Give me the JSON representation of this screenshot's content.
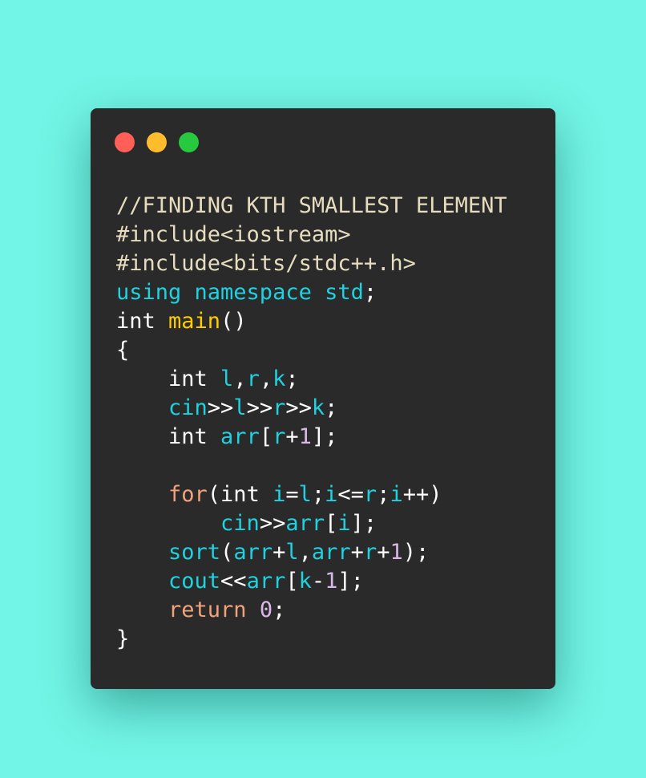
{
  "colors": {
    "background": "#72f5e6",
    "window": "#2a2a2a",
    "dot_close": "#ff5f56",
    "dot_minimize": "#ffbd2e",
    "dot_maximize": "#27c93f"
  },
  "code": {
    "lines": [
      [
        {
          "t": "//FINDING KTH SMALLEST ELEMENT",
          "c": "comment"
        }
      ],
      [
        {
          "t": "#include<iostream>",
          "c": "include"
        }
      ],
      [
        {
          "t": "#include<bits/stdc++.h>",
          "c": "include"
        }
      ],
      [
        {
          "t": "using namespace std",
          "c": "using"
        },
        {
          "t": ";",
          "c": "plain"
        }
      ],
      [
        {
          "t": "int ",
          "c": "type"
        },
        {
          "t": "main",
          "c": "func"
        },
        {
          "t": "()",
          "c": "plain"
        }
      ],
      [
        {
          "t": "{",
          "c": "plain"
        }
      ],
      [
        {
          "t": "    int ",
          "c": "type"
        },
        {
          "t": "l",
          "c": "var"
        },
        {
          "t": ",",
          "c": "plain"
        },
        {
          "t": "r",
          "c": "var"
        },
        {
          "t": ",",
          "c": "plain"
        },
        {
          "t": "k",
          "c": "var"
        },
        {
          "t": ";",
          "c": "plain"
        }
      ],
      [
        {
          "t": "    cin",
          "c": "var"
        },
        {
          "t": ">>",
          "c": "plain"
        },
        {
          "t": "l",
          "c": "var"
        },
        {
          "t": ">>",
          "c": "plain"
        },
        {
          "t": "r",
          "c": "var"
        },
        {
          "t": ">>",
          "c": "plain"
        },
        {
          "t": "k",
          "c": "var"
        },
        {
          "t": ";",
          "c": "plain"
        }
      ],
      [
        {
          "t": "    int ",
          "c": "type"
        },
        {
          "t": "arr",
          "c": "var"
        },
        {
          "t": "[",
          "c": "plain"
        },
        {
          "t": "r",
          "c": "var"
        },
        {
          "t": "+",
          "c": "plain"
        },
        {
          "t": "1",
          "c": "num"
        },
        {
          "t": "];",
          "c": "plain"
        }
      ],
      [
        {
          "t": "",
          "c": "plain"
        }
      ],
      [
        {
          "t": "    for",
          "c": "kw"
        },
        {
          "t": "(int ",
          "c": "plain"
        },
        {
          "t": "i",
          "c": "var"
        },
        {
          "t": "=",
          "c": "plain"
        },
        {
          "t": "l",
          "c": "var"
        },
        {
          "t": ";",
          "c": "plain"
        },
        {
          "t": "i",
          "c": "var"
        },
        {
          "t": "<=",
          "c": "plain"
        },
        {
          "t": "r",
          "c": "var"
        },
        {
          "t": ";",
          "c": "plain"
        },
        {
          "t": "i",
          "c": "var"
        },
        {
          "t": "++)",
          "c": "plain"
        }
      ],
      [
        {
          "t": "        cin",
          "c": "var"
        },
        {
          "t": ">>",
          "c": "plain"
        },
        {
          "t": "arr",
          "c": "var"
        },
        {
          "t": "[",
          "c": "plain"
        },
        {
          "t": "i",
          "c": "var"
        },
        {
          "t": "];",
          "c": "plain"
        }
      ],
      [
        {
          "t": "    sort",
          "c": "var"
        },
        {
          "t": "(",
          "c": "plain"
        },
        {
          "t": "arr",
          "c": "var"
        },
        {
          "t": "+",
          "c": "plain"
        },
        {
          "t": "l",
          "c": "var"
        },
        {
          "t": ",",
          "c": "plain"
        },
        {
          "t": "arr",
          "c": "var"
        },
        {
          "t": "+",
          "c": "plain"
        },
        {
          "t": "r",
          "c": "var"
        },
        {
          "t": "+",
          "c": "plain"
        },
        {
          "t": "1",
          "c": "num"
        },
        {
          "t": ");",
          "c": "plain"
        }
      ],
      [
        {
          "t": "    cout",
          "c": "var"
        },
        {
          "t": "<<",
          "c": "plain"
        },
        {
          "t": "arr",
          "c": "var"
        },
        {
          "t": "[",
          "c": "plain"
        },
        {
          "t": "k",
          "c": "var"
        },
        {
          "t": "-",
          "c": "plain"
        },
        {
          "t": "1",
          "c": "num"
        },
        {
          "t": "];",
          "c": "plain"
        }
      ],
      [
        {
          "t": "    return ",
          "c": "kw"
        },
        {
          "t": "0",
          "c": "num"
        },
        {
          "t": ";",
          "c": "plain"
        }
      ],
      [
        {
          "t": "}",
          "c": "plain"
        }
      ]
    ]
  }
}
